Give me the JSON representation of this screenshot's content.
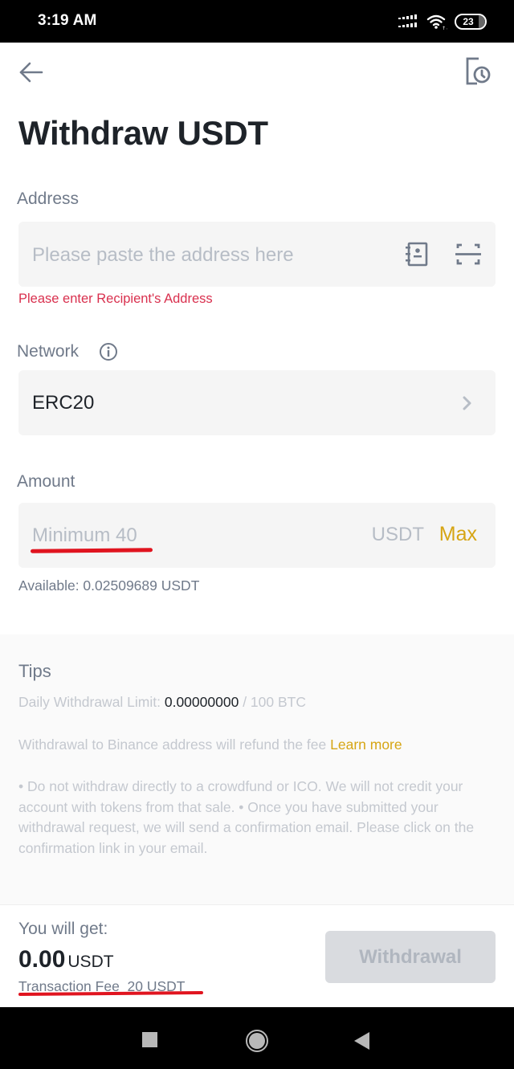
{
  "status_bar": {
    "time": "3:19 AM",
    "battery": "23",
    "icons": [
      "signal-icon",
      "wifi-icon",
      "battery-icon"
    ]
  },
  "header": {
    "back_icon": "arrow-left-icon",
    "history_icon": "history-record-icon",
    "title": "Withdraw USDT"
  },
  "address": {
    "label": "Address",
    "placeholder": "Please paste the address here",
    "value": "",
    "address_book_icon": "address-book-icon",
    "scan_icon": "scan-qr-icon",
    "error": "Please enter Recipient's Address"
  },
  "network": {
    "label": "Network",
    "info_icon": "info-icon",
    "value": "ERC20",
    "chevron_icon": "chevron-right-icon"
  },
  "amount": {
    "label": "Amount",
    "placeholder": "Minimum 40",
    "value": "",
    "unit": "USDT",
    "max_label": "Max",
    "available": "Available: 0.02509689 USDT"
  },
  "tips": {
    "title": "Tips",
    "limit_label": "Daily Withdrawal Limit: ",
    "limit_used": "0.00000000",
    "limit_total": " / 100 BTC",
    "refund_text": "Withdrawal to Binance address will refund the fee ",
    "learn_more": "Learn more",
    "notice": "• Do not withdraw directly to a crowdfund or ICO. We will not credit your account with tokens from that sale. • Once you have submitted your withdrawal request, we will send a confirmation email. Please click on the confirmation link in your email."
  },
  "summary": {
    "get_label": "You will get:",
    "get_amount": "0.00",
    "get_unit": "USDT",
    "fee": "Transaction Fee  20 USDT",
    "withdraw_button": "Withdrawal"
  },
  "colors": {
    "accent": "#d6a514",
    "error": "#d9304e",
    "annotation": "#e0141f",
    "field_bg": "#f5f5f5",
    "disabled_button": "#d9dbdf"
  },
  "nav_bar": {
    "buttons": [
      "recents-icon",
      "home-icon",
      "back-triangle-icon"
    ]
  }
}
